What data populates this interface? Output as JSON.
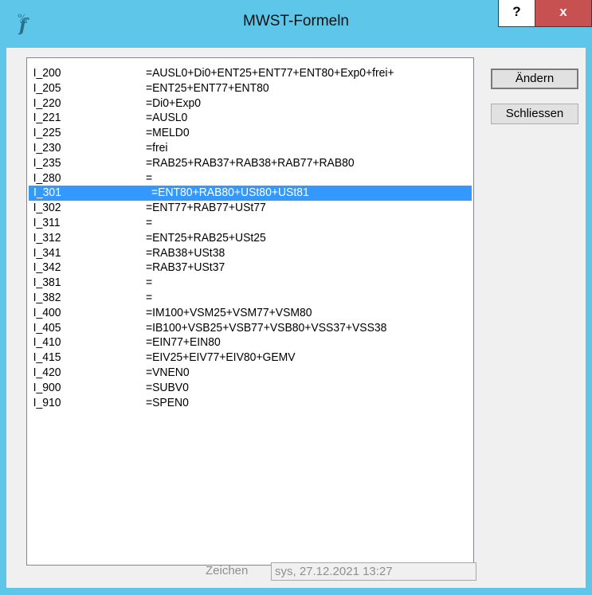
{
  "window": {
    "title": "MWST-Formeln",
    "help_label": "?",
    "close_label": "x",
    "frame_color": "#5ec7e9",
    "close_color": "#c75050"
  },
  "list": {
    "selected_index": 8,
    "selection_color": "#3399ff",
    "items": [
      {
        "code": "I_200",
        "formula": "=AUSL0+Di0+ENT25+ENT77+ENT80+Exp0+frei+"
      },
      {
        "code": "I_205",
        "formula": "=ENT25+ENT77+ENT80"
      },
      {
        "code": "I_220",
        "formula": "=Di0+Exp0"
      },
      {
        "code": "I_221",
        "formula": "=AUSL0"
      },
      {
        "code": "I_225",
        "formula": "=MELD0"
      },
      {
        "code": "I_230",
        "formula": "=frei"
      },
      {
        "code": "I_235",
        "formula": "=RAB25+RAB37+RAB38+RAB77+RAB80"
      },
      {
        "code": "I_280",
        "formula": "="
      },
      {
        "code": "I_301",
        "formula": "=ENT80+RAB80+USt80+USt81"
      },
      {
        "code": "I_302",
        "formula": "=ENT77+RAB77+USt77"
      },
      {
        "code": "I_311",
        "formula": "="
      },
      {
        "code": "I_312",
        "formula": "=ENT25+RAB25+USt25"
      },
      {
        "code": "I_341",
        "formula": "=RAB38+USt38"
      },
      {
        "code": "I_342",
        "formula": "=RAB37+USt37"
      },
      {
        "code": "I_381",
        "formula": "="
      },
      {
        "code": "I_382",
        "formula": "="
      },
      {
        "code": "I_400",
        "formula": "=IM100+VSM25+VSM77+VSM80"
      },
      {
        "code": "I_405",
        "formula": "=IB100+VSB25+VSB77+VSB80+VSS37+VSS38"
      },
      {
        "code": "I_410",
        "formula": "=EIN77+EIN80"
      },
      {
        "code": "I_415",
        "formula": "=EIV25+EIV77+EIV80+GEMV"
      },
      {
        "code": "I_420",
        "formula": "=VNEN0"
      },
      {
        "code": "I_900",
        "formula": "=SUBV0"
      },
      {
        "code": "I_910",
        "formula": "=SPEN0"
      }
    ]
  },
  "buttons": {
    "aendern": "Ändern",
    "schliessen": "Schliessen"
  },
  "footer": {
    "zeichen_label": "Zeichen",
    "zeichen_value": "sys, 27.12.2021  13:27"
  }
}
